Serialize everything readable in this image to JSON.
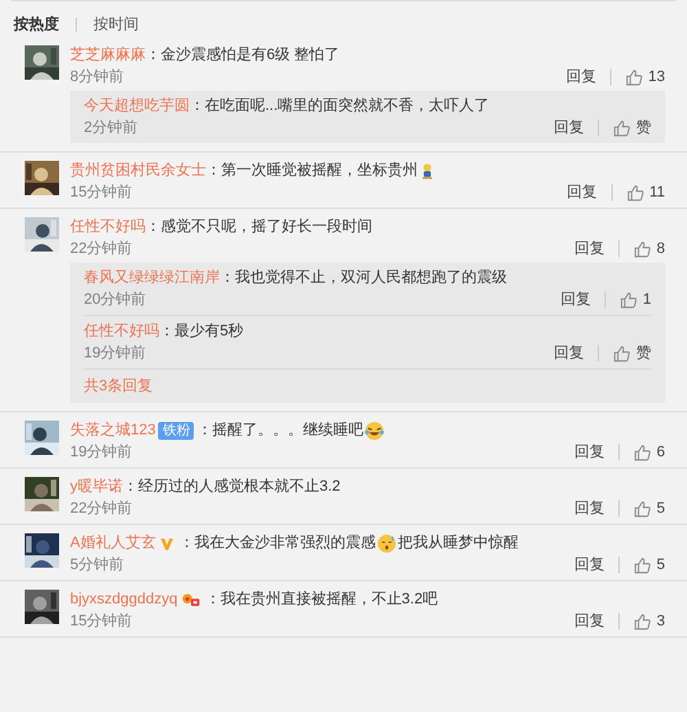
{
  "sort_tabs": [
    {
      "label": "按热度",
      "selected": true
    },
    {
      "label": "按时间",
      "selected": false
    }
  ],
  "comments": [
    {
      "name": "芝芝麻麻麻",
      "content": [
        {
          "kind": "text",
          "text": "：金沙震感怕是有6级 整怕了"
        }
      ],
      "time": "8分钟前",
      "reply_label": "回复",
      "likes": "13",
      "replies": [
        {
          "name": "今天超想吃芋圆",
          "content": [
            {
              "kind": "text",
              "text": "：在吃面呢...嘴里的面突然就不香，太吓人了"
            }
          ],
          "time": "2分钟前",
          "reply_label": "回复",
          "likes": "赞"
        }
      ]
    },
    {
      "name": "贵州贫困村民余女士",
      "content": [
        {
          "kind": "text",
          "text": "：第一次睡觉被摇醒，坐标贵州"
        },
        {
          "kind": "figure-emoji"
        }
      ],
      "time": "15分钟前",
      "reply_label": "回复",
      "likes": "11"
    },
    {
      "name": "任性不好吗",
      "content": [
        {
          "kind": "text",
          "text": "：感觉不只呢，摇了好长一段时间"
        }
      ],
      "time": "22分钟前",
      "reply_label": "回复",
      "likes": "8",
      "replies": [
        {
          "name": "春风又绿绿绿江南岸",
          "content": [
            {
              "kind": "text",
              "text": "：我也觉得不止，双河人民都想跑了的震级"
            }
          ],
          "time": "20分钟前",
          "reply_label": "回复",
          "likes": "1"
        },
        {
          "name": "任性不好吗",
          "content": [
            {
              "kind": "text",
              "text": "：最少有5秒"
            }
          ],
          "time": "19分钟前",
          "reply_label": "回复",
          "likes": "赞"
        }
      ],
      "more_replies": "共3条回复"
    },
    {
      "name": "失落之城123",
      "badge": {
        "kind": "label",
        "text": "铁粉"
      },
      "content": [
        {
          "kind": "text",
          "text": "：摇醒了。。。继续睡吧"
        },
        {
          "kind": "laughing-emoji"
        }
      ],
      "time": "19分钟前",
      "reply_label": "回复",
      "likes": "6"
    },
    {
      "name": "y暖毕诺",
      "content": [
        {
          "kind": "text",
          "text": "：经历过的人感觉根本就不止3.2"
        }
      ],
      "time": "22分钟前",
      "reply_label": "回复",
      "likes": "5"
    },
    {
      "name": "A婚礼人艾玄",
      "badge": {
        "kind": "verified"
      },
      "content": [
        {
          "kind": "text",
          "text": "：我在大金沙非常强烈的震感"
        },
        {
          "kind": "sweat-emoji"
        },
        {
          "kind": "text",
          "text": "把我从睡梦中惊醒"
        }
      ],
      "time": "5分钟前",
      "reply_label": "回复",
      "likes": "5"
    },
    {
      "name": "bjyxszdggddzyq",
      "badge": {
        "kind": "fan"
      },
      "content": [
        {
          "kind": "text",
          "text": "：我在贵州直接被摇醒，不止3.2吧"
        }
      ],
      "time": "15分钟前",
      "reply_label": "回复",
      "likes": "3"
    }
  ]
}
